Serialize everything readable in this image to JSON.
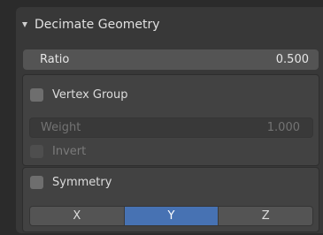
{
  "panel": {
    "title": "Decimate Geometry",
    "ratio": {
      "label": "Ratio",
      "value": "0.500"
    },
    "vertex_group": {
      "label": "Vertex Group",
      "checked": false,
      "weight": {
        "label": "Weight",
        "value": "1.000"
      },
      "invert": {
        "label": "Invert",
        "checked": false
      }
    },
    "symmetry": {
      "label": "Symmetry",
      "checked": false,
      "axes": [
        "X",
        "Y",
        "Z"
      ],
      "selected_axis": "Y"
    }
  },
  "colors": {
    "accent": "#4772b3"
  }
}
